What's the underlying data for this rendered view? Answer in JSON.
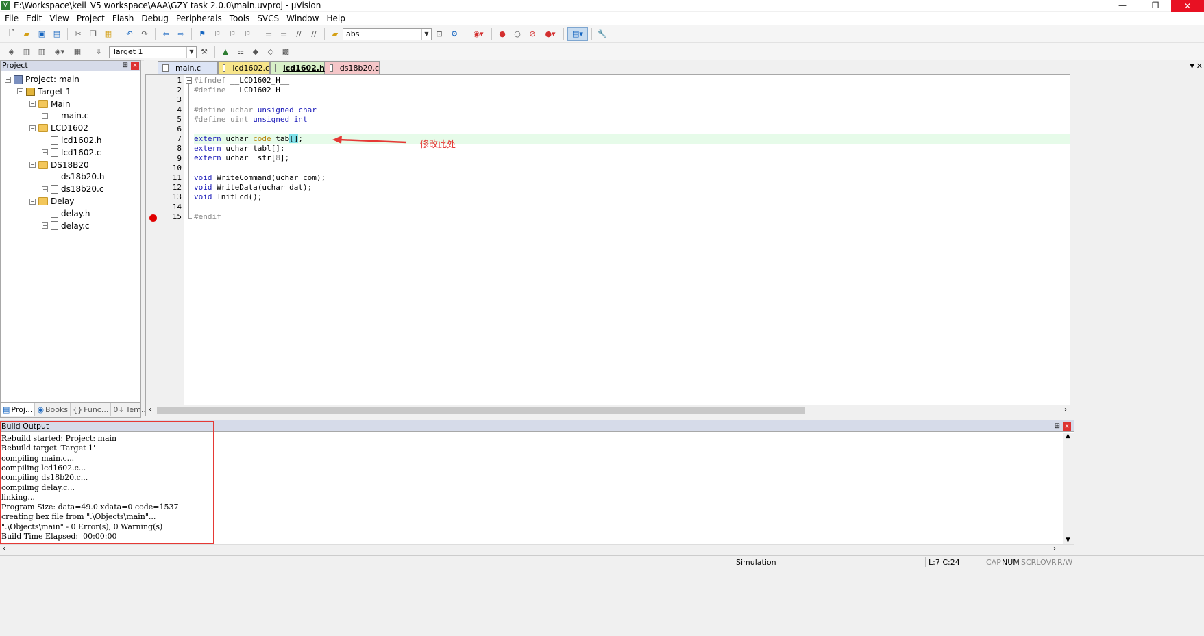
{
  "window": {
    "title": "E:\\Workspace\\keil_V5 workspace\\AAA\\GZY task 2.0.0\\main.uvproj - µVision",
    "app_icon_letter": "V",
    "minimize": "—",
    "restore": "❐",
    "close": "✕"
  },
  "menu": [
    "File",
    "Edit",
    "View",
    "Project",
    "Flash",
    "Debug",
    "Peripherals",
    "Tools",
    "SVCS",
    "Window",
    "Help"
  ],
  "toolbar": {
    "find_value": "abs",
    "target_value": "Target 1"
  },
  "project_panel": {
    "title": "Project",
    "pin": "⊞",
    "close": "x",
    "tree": [
      {
        "label": "Project: main",
        "level": 0,
        "toggle": "−",
        "icon": "project"
      },
      {
        "label": "Target 1",
        "level": 1,
        "toggle": "−",
        "icon": "target"
      },
      {
        "label": "Main",
        "level": 2,
        "toggle": "−",
        "icon": "folder"
      },
      {
        "label": "main.c",
        "level": 3,
        "toggle": "+",
        "icon": "file"
      },
      {
        "label": "LCD1602",
        "level": 2,
        "toggle": "−",
        "icon": "folder"
      },
      {
        "label": "lcd1602.h",
        "level": 3,
        "toggle": "",
        "icon": "file"
      },
      {
        "label": "lcd1602.c",
        "level": 3,
        "toggle": "+",
        "icon": "file"
      },
      {
        "label": "DS18B20",
        "level": 2,
        "toggle": "−",
        "icon": "folder"
      },
      {
        "label": "ds18b20.h",
        "level": 3,
        "toggle": "",
        "icon": "file"
      },
      {
        "label": "ds18b20.c",
        "level": 3,
        "toggle": "+",
        "icon": "file"
      },
      {
        "label": "Delay",
        "level": 2,
        "toggle": "−",
        "icon": "folder"
      },
      {
        "label": "delay.h",
        "level": 3,
        "toggle": "",
        "icon": "file"
      },
      {
        "label": "delay.c",
        "level": 3,
        "toggle": "+",
        "icon": "file"
      }
    ],
    "tabs": [
      "Proj...",
      "Books",
      "Func...",
      "Tem..."
    ]
  },
  "editor": {
    "tabs": [
      {
        "label": "main.c",
        "color": "#dce4f5"
      },
      {
        "label": "lcd1602.c",
        "color": "#f7e58a"
      },
      {
        "label": "lcd1602.h",
        "color": "#d8f0c8"
      },
      {
        "label": "ds18b20.c",
        "color": "#f5c6c8"
      }
    ],
    "line_numbers": [
      "1",
      "2",
      "3",
      "4",
      "5",
      "6",
      "7",
      "8",
      "9",
      "10",
      "11",
      "12",
      "13",
      "14",
      "15"
    ],
    "lines": {
      "l1": {
        "pre": "#ifndef",
        "rest": " __LCD1602_H__"
      },
      "l2": {
        "pre": "#define",
        "rest": " __LCD1602_H__"
      },
      "l4": {
        "pre": "#define uchar",
        "kw": "unsigned char"
      },
      "l5": {
        "pre": "#define uint",
        "kw": "unsigned int"
      },
      "l7": {
        "kw": "extern",
        "mid": " uchar ",
        "kw2": "code",
        "name": " tab",
        "br": "[]",
        "end": ";"
      },
      "l8": {
        "kw": "extern",
        "rest": " uchar tabl[];"
      },
      "l9": {
        "kw": "extern",
        "rest": " uchar  str[",
        "num": "8",
        "end": "];"
      },
      "l11": {
        "kw": "void",
        "rest": " WriteCommand(uchar com);"
      },
      "l12": {
        "kw": "void",
        "rest": " WriteData(uchar dat);"
      },
      "l13": {
        "kw": "void",
        "rest": " InitLcd();"
      },
      "l15": {
        "pre": "#endif"
      }
    },
    "annotation": "修改此处",
    "dropdown": "▼",
    "close": "✕"
  },
  "build_output": {
    "title": "Build Output",
    "lines": [
      "Rebuild started: Project: main",
      "Rebuild target 'Target 1'",
      "compiling main.c...",
      "compiling lcd1602.c...",
      "compiling ds18b20.c...",
      "compiling delay.c...",
      "linking...",
      "Program Size: data=49.0 xdata=0 code=1537",
      "creating hex file from \".\\Objects\\main\"...",
      "\".\\Objects\\main\" - 0 Error(s), 0 Warning(s)",
      "Build Time Elapsed:  00:00:00"
    ]
  },
  "status": {
    "mode": "Simulation",
    "position": "L:7 C:24",
    "cap": "CAP",
    "num": "NUM",
    "scrl": "SCRL",
    "ovr": "OVR",
    "rw": "R/W"
  }
}
